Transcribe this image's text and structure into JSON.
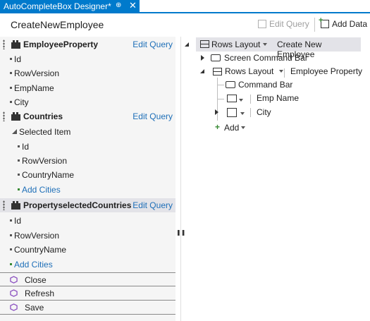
{
  "tab": {
    "title": "AutoCompleteBox Designer*",
    "pin": "⊕",
    "close": "✕"
  },
  "toolbar": {
    "screen_name": "CreateNewEmployee",
    "edit_query": "Edit Query",
    "add_data": "Add Data"
  },
  "left": {
    "queries": [
      {
        "name": "EmployeeProperty",
        "edit": "Edit Query",
        "props": [
          "Id",
          "RowVersion",
          "EmpName",
          "City"
        ]
      },
      {
        "name": "Countries",
        "edit": "Edit Query",
        "selected_item": "Selected Item",
        "props": [
          "Id",
          "RowVersion",
          "CountryName"
        ],
        "add": "Add Cities"
      },
      {
        "name": "PropertyselectedCountries",
        "edit": "Edit Query",
        "props": [
          "Id",
          "RowVersion",
          "CountryName"
        ],
        "add": "Add Cities"
      }
    ],
    "commands": [
      "Close",
      "Refresh",
      "Save"
    ]
  },
  "tree": {
    "root_control": "Rows Layout",
    "root_label": "Create New Employee",
    "screen_command_bar": "Screen Command Bar",
    "child_control": "Rows Layout",
    "child_label": "Employee Property",
    "command_bar": "Command Bar",
    "emp_name": "Emp Name",
    "city": "City",
    "add": "Add"
  },
  "colors": {
    "accent": "#007acc",
    "link": "#1e6fb8",
    "add_green": "#388a34",
    "command_icon": "#8a4fbf"
  }
}
